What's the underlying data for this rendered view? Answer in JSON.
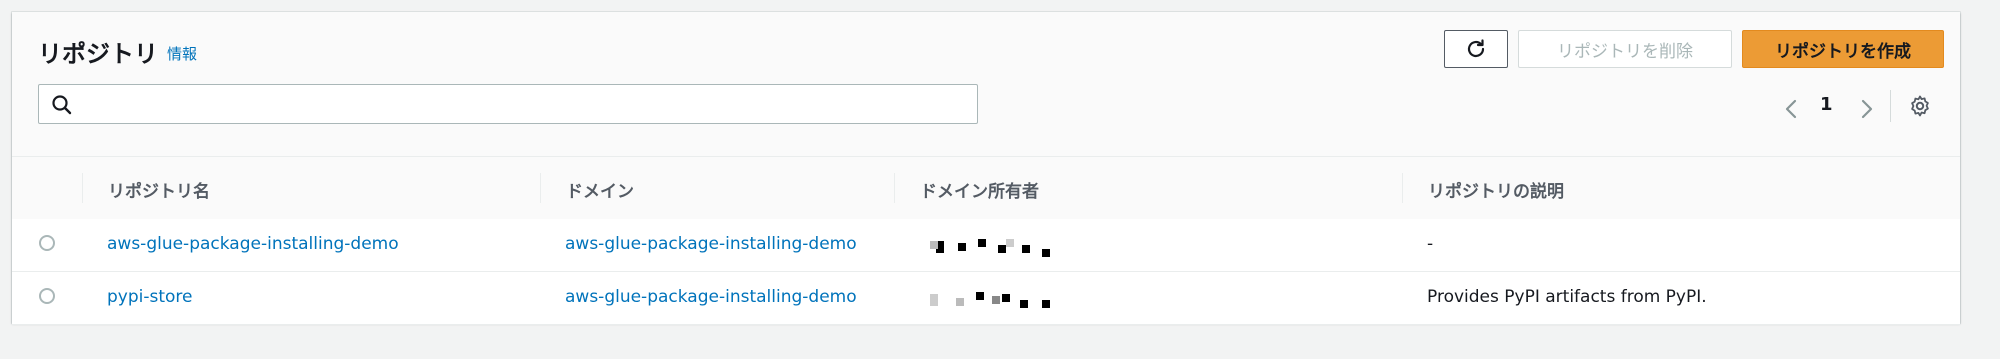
{
  "header": {
    "title": "リポジトリ",
    "info_label": "情報",
    "delete_label": "リポジトリを削除",
    "create_label": "リポジトリを作成",
    "search_placeholder": "",
    "search_value": "",
    "page_number": "1"
  },
  "table": {
    "columns": [
      "リポジトリ名",
      "ドメイン",
      "ドメイン所有者",
      "リポジトリの説明"
    ],
    "rows": [
      {
        "name": "aws-glue-package-installing-demo",
        "domain": "aws-glue-package-installing-demo",
        "owner": "",
        "description": "-",
        "selected": false
      },
      {
        "name": "pypi-store",
        "domain": "aws-glue-package-installing-demo",
        "owner": "",
        "description": "Provides PyPI artifacts from PyPI.",
        "selected": false
      }
    ]
  },
  "colors": {
    "accent": "#0073bb",
    "primary_button": "#ec9b35",
    "text": "#16191f"
  },
  "icons": [
    "refresh-icon",
    "search-icon",
    "chevron-left-icon",
    "chevron-right-icon",
    "gear-icon"
  ]
}
